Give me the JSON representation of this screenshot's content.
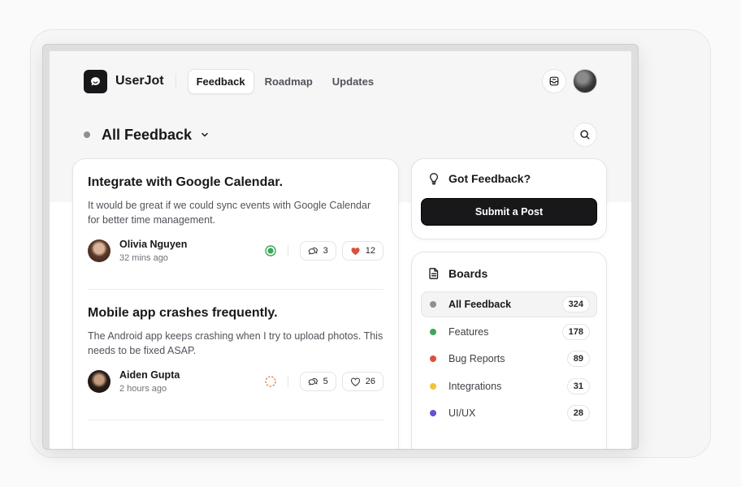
{
  "app": {
    "brand": "UserJot"
  },
  "nav": {
    "tabs": [
      {
        "label": "Feedback",
        "active": true
      },
      {
        "label": "Roadmap"
      },
      {
        "label": "Updates"
      }
    ]
  },
  "board": {
    "title": "All Feedback"
  },
  "posts": [
    {
      "title": "Integrate with Google Calendar.",
      "description": "It would be great if we could sync events with Google Calendar for better time management.",
      "author": "Olivia Nguyen",
      "time": "32 mins ago",
      "status_color": "#3fa55b",
      "comments": "3",
      "likes": "12",
      "liked": true
    },
    {
      "title": "Mobile app crashes frequently.",
      "description": "The Android app keeps crashing when I try to upload photos. This needs to be fixed ASAP.",
      "author": "Aiden Gupta",
      "time": "2 hours ago",
      "status_color": "#e8833a",
      "comments": "5",
      "likes": "26",
      "liked": false
    }
  ],
  "feedback_box": {
    "title": "Got Feedback?",
    "button": "Submit a Post"
  },
  "boards": {
    "title": "Boards",
    "items": [
      {
        "label": "All Feedback",
        "count": "324",
        "color": "#8e8e93",
        "active": true
      },
      {
        "label": "Features",
        "count": "178",
        "color": "#3fa55b"
      },
      {
        "label": "Bug Reports",
        "count": "89",
        "color": "#d9513a"
      },
      {
        "label": "Integrations",
        "count": "31",
        "color": "#f3c23a"
      },
      {
        "label": "UI/UX",
        "count": "28",
        "color": "#6a4fd0"
      }
    ]
  },
  "icons": {
    "logo": "chat-bubble-icon",
    "inbox": "inbox-icon",
    "search": "search-icon",
    "dropdown": "chevron-down-icon",
    "feedback": "lightbulb-icon",
    "boards": "document-icon",
    "comments": "comment-icon",
    "likes": "heart-icon"
  },
  "colors": {
    "accent_dark": "#18181b",
    "like_red": "#d9513a"
  }
}
